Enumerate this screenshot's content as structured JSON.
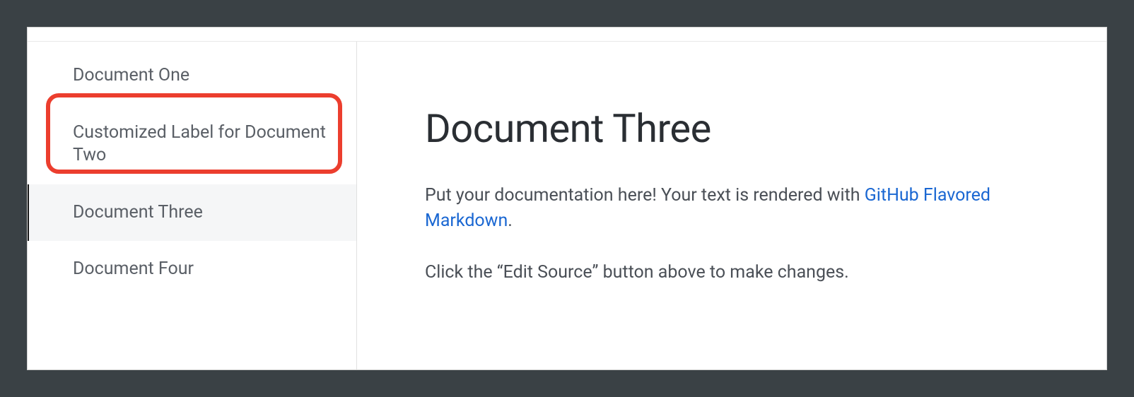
{
  "sidebar": {
    "items": [
      {
        "label": "Document One",
        "active": false,
        "highlighted": false
      },
      {
        "label": "Customized Label for Document Two",
        "active": false,
        "highlighted": true
      },
      {
        "label": "Document Three",
        "active": true,
        "highlighted": false
      },
      {
        "label": "Document Four",
        "active": false,
        "highlighted": false
      }
    ]
  },
  "main": {
    "title": "Document Three",
    "paragraph1_prefix": "Put your documentation here! Your text is rendered with ",
    "link_text": "GitHub Flavored Markdown",
    "paragraph1_suffix": ".",
    "paragraph2": "Click the “Edit Source” button above to make changes."
  }
}
